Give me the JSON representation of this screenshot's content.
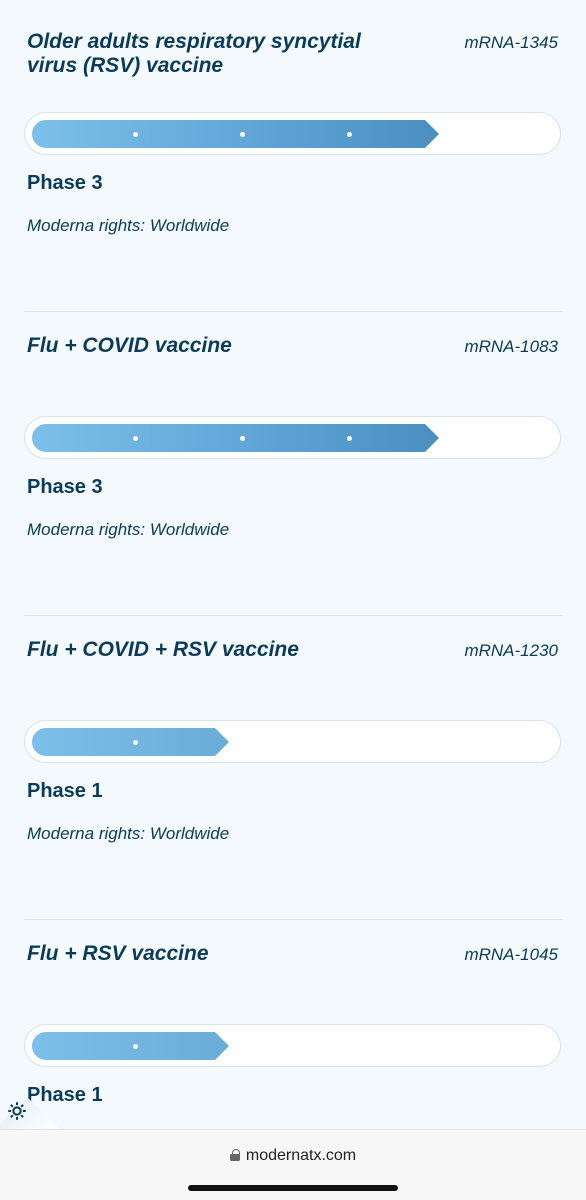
{
  "programs": [
    {
      "title": "Older adults respiratory syncytial virus (RSV) vaccine",
      "code": "mRNA-1345",
      "phase": "Phase 3",
      "phase_number": 3,
      "rights": "Moderna rights:  Worldwide"
    },
    {
      "title": "Flu + COVID vaccine",
      "code": "mRNA-1083",
      "phase": "Phase 3",
      "phase_number": 3,
      "rights": "Moderna rights:  Worldwide"
    },
    {
      "title": "Flu + COVID + RSV vaccine",
      "code": "mRNA-1230",
      "phase": "Phase 1",
      "phase_number": 1,
      "rights": "Moderna rights:  Worldwide"
    },
    {
      "title": "Flu + RSV vaccine",
      "code": "mRNA-1045",
      "phase": "Phase 1",
      "phase_number": 1
    }
  ],
  "browser": {
    "url": "modernatx.com"
  },
  "icons": {
    "lock": "lock-icon",
    "settings": "gear-icon"
  },
  "colors": {
    "text": "#0b3b57",
    "bar_start": "#7cc0ea",
    "bar_end": "#4a8fc0",
    "background": "#f3f9fc"
  }
}
